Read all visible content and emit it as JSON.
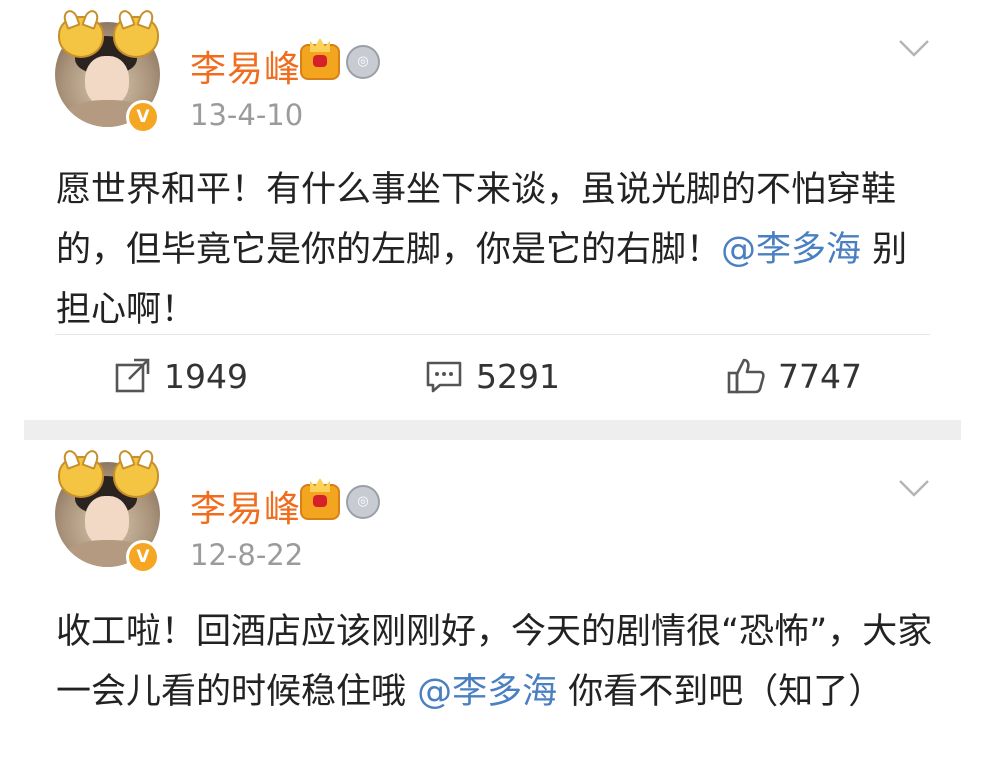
{
  "posts": [
    {
      "username": "李易峰",
      "timestamp": "13-4-10",
      "text_before": "愿世界和平！有什么事坐下来谈，虽说光脚的不怕穿鞋的，但毕竟它是你的左脚，你是它的右脚！",
      "mention": "@李多海",
      "text_after": " 别担心啊！",
      "repost_count": "1949",
      "comment_count": "5291",
      "like_count": "7747"
    },
    {
      "username": "李易峰",
      "timestamp": "12-8-22",
      "text_before": "收工啦！回酒店应该刚刚好，今天的剧情很“恐怖”，大家一会儿看的时候稳住哦 ",
      "mention": "@李多海",
      "text_after": " 你看不到吧（知了）"
    }
  ],
  "colors": {
    "username": "#f06d1e",
    "mention": "#4a7fc1",
    "timestamp": "#9b9b9b",
    "separator": "#eeeeee"
  },
  "icons": {
    "badge_1": "crown-icon",
    "badge_2": "medal-icon",
    "menu": "chevron-down-icon",
    "repost": "repost-icon",
    "comment": "comment-icon",
    "like": "thumbs-up-icon",
    "verified": "verified-icon"
  }
}
